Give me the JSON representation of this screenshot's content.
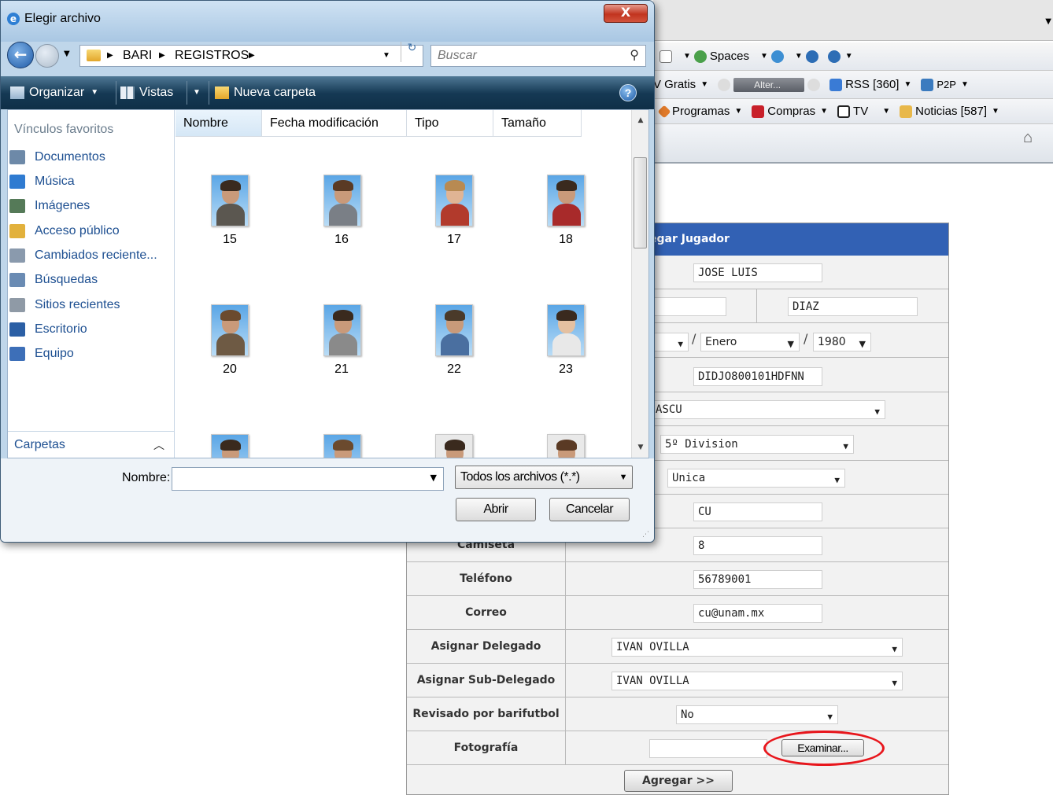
{
  "browser": {
    "toolbar1": {
      "spaces": "Spaces"
    },
    "toolbar2": {
      "tv_gratis": "V Gratis",
      "alter": "Alter...",
      "rss": "RSS [360]",
      "p2p": "P2P"
    },
    "toolbar3": {
      "programas": "Programas",
      "compras": "Compras",
      "tv": "TV",
      "noticias": "Noticias [587]"
    }
  },
  "form": {
    "header": "egar Jugador",
    "nombre": "JOSE LUIS",
    "apellido_materno": "DIAZ",
    "mes": "Enero",
    "anio": "1980",
    "rfc": "DIDJO800101HDFNN",
    "sexo": "ASCU",
    "division": "5º Division",
    "categoria": "Unica",
    "escuela": "CU",
    "camiseta_label": "Camiseta",
    "camiseta": "8",
    "telefono_label": "Teléfono",
    "telefono": "56789001",
    "correo_label": "Correo",
    "correo": "cu@unam.mx",
    "delegado_label": "Asignar Delegado",
    "delegado": "IVAN OVILLA",
    "subdelegado_label": "Asignar Sub-Delegado",
    "subdelegado": "IVAN OVILLA",
    "revisado_label": "Revisado por barifutbol",
    "revisado": "No",
    "foto_label": "Fotografía",
    "examinar": "Examinar...",
    "agregar": "Agregar >>"
  },
  "dialog": {
    "title": "Elegir archivo",
    "close": "X",
    "breadcrumb": [
      "BARI",
      "REGISTROS"
    ],
    "search_placeholder": "Buscar",
    "commands": {
      "organizar": "Organizar",
      "vistas": "Vistas",
      "nueva_carpeta": "Nueva carpeta"
    },
    "favorites_title": "Vínculos favoritos",
    "favorites": [
      {
        "label": "Documentos",
        "icon": "documents-icon",
        "color": "#6d89a8"
      },
      {
        "label": "Música",
        "icon": "music-icon",
        "color": "#2f7bd1"
      },
      {
        "label": "Imágenes",
        "icon": "pictures-icon",
        "color": "#557a58"
      },
      {
        "label": "Acceso público",
        "icon": "public-folder-icon",
        "color": "#e2b13c"
      },
      {
        "label": "Cambiados reciente...",
        "icon": "recent-changed-icon",
        "color": "#8a9aad"
      },
      {
        "label": "Búsquedas",
        "icon": "searches-icon",
        "color": "#6a8bb3"
      },
      {
        "label": "Sitios recientes",
        "icon": "recent-places-icon",
        "color": "#8f9aa6"
      },
      {
        "label": "Escritorio",
        "icon": "desktop-icon",
        "color": "#2b5fa5"
      },
      {
        "label": "Equipo",
        "icon": "computer-icon",
        "color": "#3d6fb8"
      }
    ],
    "folders_label": "Carpetas",
    "columns": [
      "Nombre",
      "Fecha modificación",
      "Tipo",
      "Tamaño"
    ],
    "files": [
      "15",
      "16",
      "17",
      "18",
      "20",
      "21",
      "22",
      "23"
    ],
    "filename_label": "Nombre:",
    "filename_value": "",
    "filter": "Todos los archivos (*.*)",
    "open": "Abrir",
    "cancel": "Cancelar"
  },
  "colors": {
    "form_header": "#3261b4",
    "highlight_oval": "#e8161c",
    "command_bar": "#153954"
  }
}
